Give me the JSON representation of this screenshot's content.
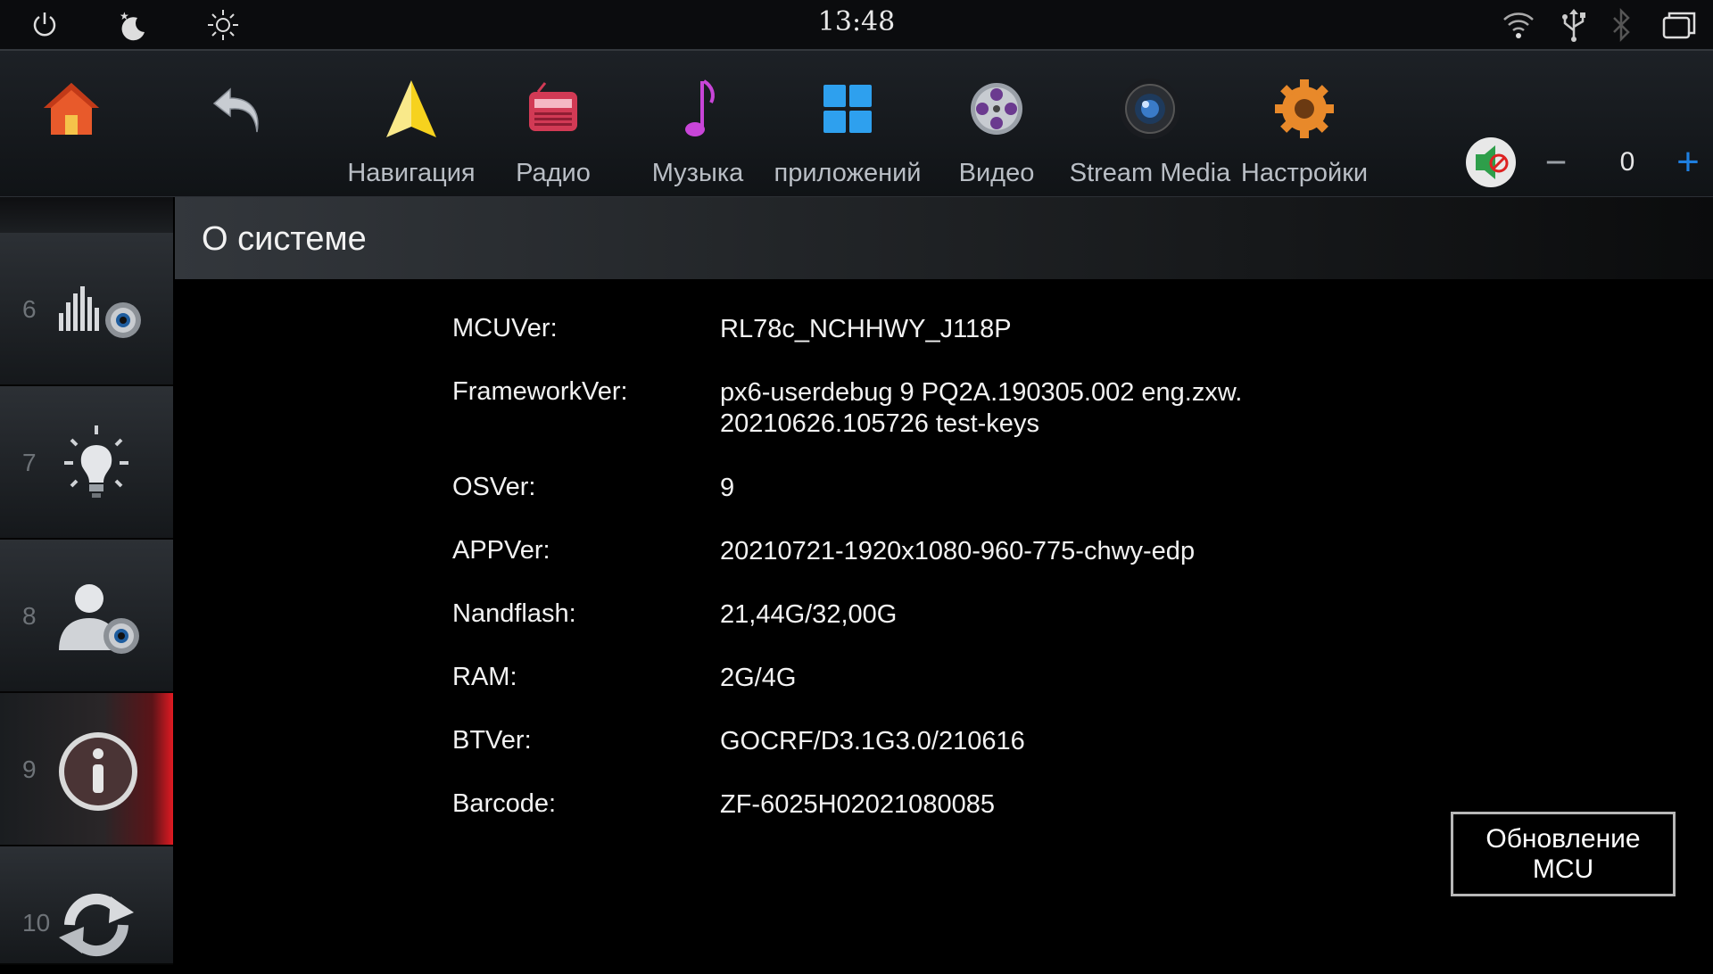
{
  "statusbar": {
    "time": "13:48",
    "icons": [
      "power-icon",
      "night-mode-icon",
      "brightness-icon",
      "wifi-icon",
      "usb-icon",
      "bluetooth-icon",
      "recent-apps-icon"
    ]
  },
  "topnav": {
    "items": [
      {
        "label": "",
        "icon": "home-icon"
      },
      {
        "label": "",
        "icon": "back-icon"
      },
      {
        "label": "Навигация",
        "icon": "navigation-icon"
      },
      {
        "label": "Радио",
        "icon": "radio-icon"
      },
      {
        "label": "Музыка",
        "icon": "music-icon"
      },
      {
        "label": "приложений",
        "icon": "apps-icon"
      },
      {
        "label": "Видео",
        "icon": "video-icon"
      },
      {
        "label": "Stream Media",
        "icon": "stream-media-icon"
      },
      {
        "label": "Настройки",
        "icon": "settings-icon"
      }
    ],
    "volume": {
      "value": "0",
      "minus": "−",
      "plus": "+"
    }
  },
  "sidebar": {
    "items": [
      {
        "number": "6",
        "icon": "equalizer-settings-icon"
      },
      {
        "number": "7",
        "icon": "lighting-icon"
      },
      {
        "number": "8",
        "icon": "user-settings-icon"
      },
      {
        "number": "9",
        "icon": "info-icon",
        "active": true
      },
      {
        "number": "10",
        "icon": "update-icon"
      }
    ]
  },
  "content": {
    "title": "О системе",
    "rows": [
      {
        "key": "MCUVer:",
        "value": "RL78c_NCHHWY_J118P"
      },
      {
        "key": "FrameworkVer:",
        "value": "px6-userdebug 9 PQ2A.190305.002 eng.zxw.",
        "value2": "20210626.105726 test-keys"
      },
      {
        "key": "OSVer:",
        "value": "9"
      },
      {
        "key": "APPVer:",
        "value": "20210721-1920x1080-960-775-chwy-edp"
      },
      {
        "key": "Nandflash:",
        "value": "21,44G/32,00G"
      },
      {
        "key": "RAM:",
        "value": "2G/4G"
      },
      {
        "key": "BTVer:",
        "value": "GOCRF/D3.1G3.0/210616"
      },
      {
        "key": "Barcode:",
        "value": "ZF-6025H02021080085"
      }
    ],
    "mcu_update_button": "Обновление MCU"
  },
  "colors": {
    "accent_red": "#e01a22",
    "plus_blue": "#1e7fe0"
  }
}
